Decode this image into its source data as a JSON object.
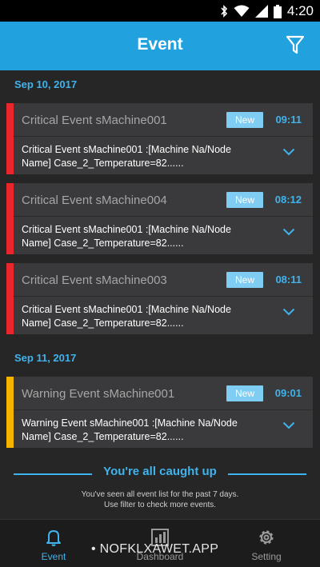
{
  "status_bar": {
    "time": "4:20"
  },
  "header": {
    "title": "Event",
    "filter_icon": "filter-icon"
  },
  "groups": [
    {
      "date": "Sep 10, 2017",
      "events": [
        {
          "title": "Critical Event sMachine001",
          "badge": "New",
          "time": "09:11",
          "detail": "Critical Event sMachine001 :[Machine Na/Node Name] Case_2_Temperature=82......",
          "severity_color": "#e8262c"
        },
        {
          "title": "Critical Event sMachine004",
          "badge": "New",
          "time": "08:12",
          "detail": "Critical Event sMachine001 :[Machine Na/Node Name] Case_2_Temperature=82......",
          "severity_color": "#e8262c"
        },
        {
          "title": "Critical Event sMachine003",
          "badge": "New",
          "time": "08:11",
          "detail": "Critical Event sMachine001 :[Machine Na/Node Name] Case_2_Temperature=82......",
          "severity_color": "#e8262c"
        }
      ]
    },
    {
      "date": "Sep 11, 2017",
      "events": [
        {
          "title": "Warning Event sMachine001",
          "badge": "New",
          "time": "09:01",
          "detail": "Warning Event sMachine001 :[Machine Na/Node Name] Case_2_Temperature=82......",
          "severity_color": "#f5b400"
        }
      ]
    }
  ],
  "caught_up": {
    "heading": "You're all caught up",
    "line1": "You've seen all event list for the past 7 days.",
    "line2": "Use filter to check more events."
  },
  "nav": {
    "items": [
      {
        "label": "Event",
        "icon": "bell-icon"
      },
      {
        "label": "Dashboard",
        "icon": "dashboard-icon"
      },
      {
        "label": "Setting",
        "icon": "gear-icon"
      }
    ]
  },
  "watermark": "• NOFKLXAWET.APP",
  "colors": {
    "accent": "#22a1df",
    "link": "#3fb3ec",
    "critical": "#e8262c",
    "warning": "#f5b400"
  }
}
